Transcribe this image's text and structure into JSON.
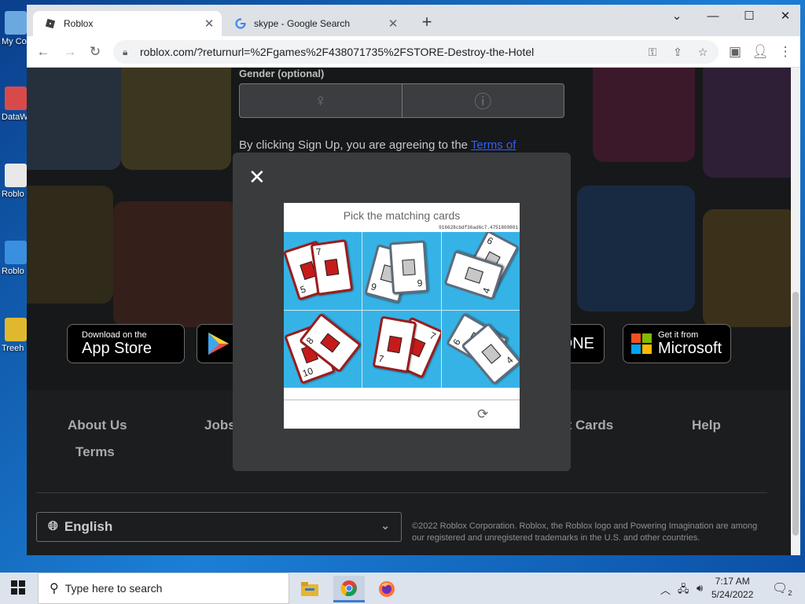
{
  "desktop": {
    "icons": [
      {
        "label": "My Co"
      },
      {
        "label": "DataW"
      },
      {
        "label": "Roblo"
      },
      {
        "label": "Roblo"
      },
      {
        "label": "Treeh"
      }
    ]
  },
  "browser": {
    "tabs": [
      {
        "title": "Roblox",
        "active": true
      },
      {
        "title": "skype - Google Search",
        "active": false
      }
    ],
    "url": "roblox.com/?returnurl=%2Fgames%2F438071735%2FSTORE-Destroy-the-Hotel"
  },
  "page": {
    "gender_label": "Gender (optional)",
    "agree_text": "By clicking Sign Up, you are agreeing to the ",
    "terms_link": "Terms of",
    "stores": {
      "appstore_small": "Download on the",
      "appstore_big": "App Store",
      "xbox_big": "ONE",
      "microsoft_small": "Get it from",
      "microsoft_big": "Microsoft"
    },
    "footer": {
      "links": [
        "About Us",
        "Jobs",
        "Gift Cards",
        "Help",
        "Terms"
      ],
      "language": "English",
      "copyright": "©2022 Roblox Corporation. Roblox, the Roblox logo and Powering Imagination are among our registered and unregistered trademarks in the U.S. and other countries."
    }
  },
  "captcha": {
    "title": "Pick the matching cards",
    "id": "916628cbdf36ad6c7.4751809801",
    "cells": [
      {
        "cards": [
          {
            "num": "5"
          },
          {
            "num": "7"
          }
        ]
      },
      {
        "cards": [
          {
            "num": "9"
          },
          {
            "num": "9"
          }
        ]
      },
      {
        "cards": [
          {
            "num": "6"
          },
          {
            "num": "4"
          }
        ]
      },
      {
        "cards": [
          {
            "num": "10"
          },
          {
            "num": "8"
          }
        ]
      },
      {
        "cards": [
          {
            "num": "7"
          },
          {
            "num": "7"
          }
        ]
      },
      {
        "cards": [
          {
            "num": "6"
          },
          {
            "num": "4"
          }
        ]
      }
    ]
  },
  "taskbar": {
    "search_placeholder": "Type here to search",
    "time": "7:17 AM",
    "date": "5/24/2022",
    "notifications": "2"
  }
}
